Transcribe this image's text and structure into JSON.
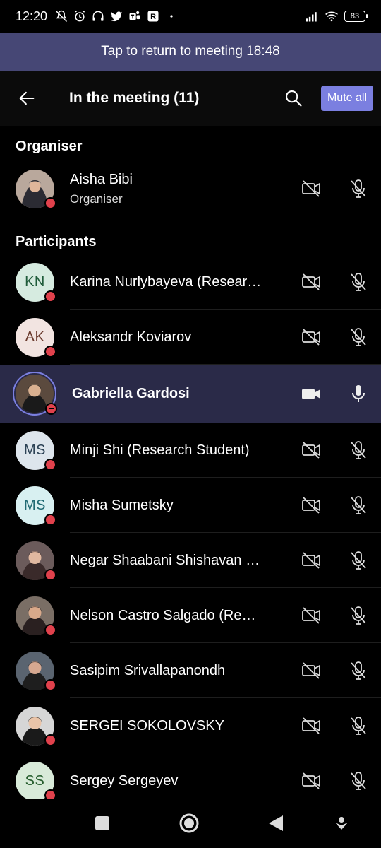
{
  "status_bar": {
    "time": "12:20",
    "battery": "83",
    "left_icons": [
      "mute-icon",
      "alarm-icon",
      "headphones-icon",
      "twitter-icon",
      "teams-icon",
      "r-app-icon",
      "dot-icon"
    ],
    "right_icons": [
      "signal-icon",
      "wifi-icon",
      "battery-icon"
    ]
  },
  "banner": {
    "text": "Tap to return to meeting 18:48"
  },
  "header": {
    "title": "In the meeting (11)",
    "mute_all_label": "Mute all"
  },
  "sections": {
    "organiser_title": "Organiser",
    "participants_title": "Participants"
  },
  "organiser": {
    "name": "Aisha Bibi",
    "role": "Organiser",
    "avatar": "photo"
  },
  "participants": [
    {
      "name": "Karina Nurlybayeva (Resear…",
      "initials": "KN",
      "avatar_bg": "#d6ebe0",
      "avatar_fg": "#1f5c3a",
      "presence": "busy"
    },
    {
      "name": "Aleksandr Koviarov",
      "initials": "AK",
      "avatar_bg": "#f2e4e1",
      "avatar_fg": "#6b3b2e",
      "presence": "busy"
    },
    {
      "name": "Gabriella Gardosi",
      "initials": "",
      "avatar": "photo",
      "presence": "dnd",
      "active": true
    },
    {
      "name": "Minji Shi (Research Student)",
      "initials": "MS",
      "avatar_bg": "#dde5ec",
      "avatar_fg": "#2d4356",
      "presence": "busy"
    },
    {
      "name": "Misha Sumetsky",
      "initials": "MS",
      "avatar_bg": "#d8f0f1",
      "avatar_fg": "#1f6a73",
      "presence": "busy"
    },
    {
      "name": "Negar Shaabani Shishavan …",
      "initials": "",
      "avatar": "photo",
      "presence": "busy"
    },
    {
      "name": "Nelson Castro Salgado (Re…",
      "initials": "",
      "avatar": "photo",
      "presence": "busy"
    },
    {
      "name": "Sasipim Srivallapanondh",
      "initials": "",
      "avatar": "photo",
      "presence": "busy"
    },
    {
      "name": "SERGEI SOKOLOVSKY",
      "initials": "",
      "avatar": "photo",
      "presence": "busy"
    },
    {
      "name": "Sergey Sergeyev",
      "initials": "SS",
      "avatar_bg": "#d8ead9",
      "avatar_fg": "#245c2c",
      "presence": "busy"
    }
  ],
  "colors": {
    "banner": "#464775",
    "accent": "#7b7fe0",
    "active_row": "#2a2a48",
    "presence_busy": "#e0414c"
  },
  "nav": {
    "icons": [
      "recents-square-icon",
      "home-circle-icon",
      "back-triangle-icon",
      "assistant-icon"
    ]
  }
}
